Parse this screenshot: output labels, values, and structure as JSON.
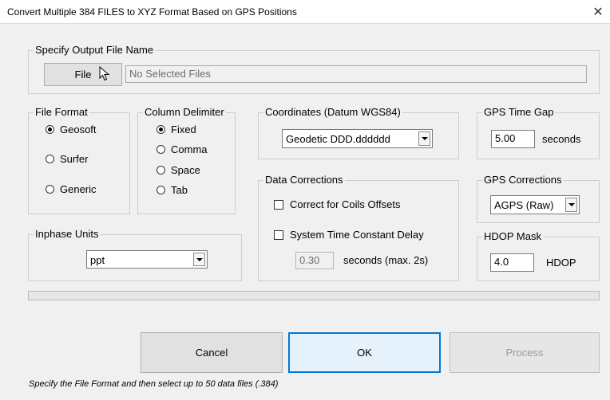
{
  "window": {
    "title": "Convert Multiple 384 FILES to XYZ Format Based on GPS Positions",
    "close_glyph": "✕"
  },
  "output": {
    "legend": "Specify Output File Name",
    "file_button": "File",
    "file_value": "No Selected Files"
  },
  "file_format": {
    "legend": "File Format",
    "options": [
      "Geosoft",
      "Surfer",
      "Generic"
    ],
    "selected": "Geosoft"
  },
  "column_delimiter": {
    "legend": "Column Delimiter",
    "options": [
      "Fixed",
      "Comma",
      "Space",
      "Tab"
    ],
    "selected": "Fixed"
  },
  "coordinates": {
    "legend": "Coordinates (Datum WGS84)",
    "selected": "Geodetic DDD.dddddd"
  },
  "gps_time_gap": {
    "legend": "GPS Time Gap",
    "value": "5.00",
    "unit": "seconds"
  },
  "data_corrections": {
    "legend": "Data Corrections",
    "coils_offsets_label": "Correct for Coils Offsets",
    "coils_offsets_checked": false,
    "time_delay_label": "System Time Constant Delay",
    "time_delay_checked": false,
    "delay_value": "0.30",
    "delay_unit": "seconds (max. 2s)"
  },
  "gps_corrections": {
    "legend": "GPS Corrections",
    "selected": "AGPS (Raw)"
  },
  "inphase_units": {
    "legend": "Inphase Units",
    "selected": "ppt"
  },
  "hdop_mask": {
    "legend": "HDOP Mask",
    "value": "4.0",
    "unit": "HDOP"
  },
  "buttons": {
    "cancel": "Cancel",
    "ok": "OK",
    "process": "Process"
  },
  "status_text": "Specify the File Format and then select up to 50 data files (.384)",
  "progress": 0
}
